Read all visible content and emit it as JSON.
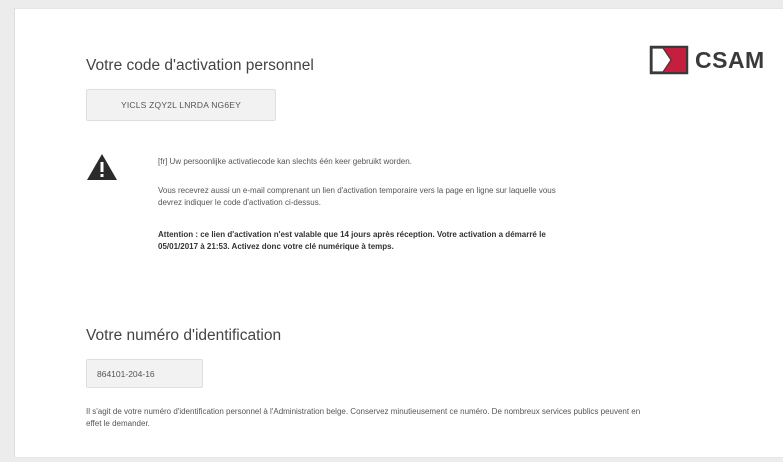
{
  "logo": {
    "text": "CSAM",
    "colors": {
      "mark": "#c41f3e",
      "frame": "#3a3a3a"
    }
  },
  "activation": {
    "title": "Votre code d'activation personnel",
    "code": "YICLS ZQY2L LNRDA NG6EY",
    "warning_icon": "warning-icon",
    "messages": {
      "nl": "[fr] Uw persoonlijke activatiecode kan slechts één keer gebruikt worden.",
      "email": "Vous recevrez aussi un e-mail comprenant un lien d'activation temporaire vers la page en ligne sur laquelle vous devrez indiquer le code d'activation ci-dessus.",
      "attention": "Attention : ce lien d'activation n'est valable que 14 jours après réception. Votre activation a démarré le 05/01/2017 à 21:53. Activez donc votre clé numérique à temps."
    }
  },
  "identification": {
    "title": "Votre numéro d'identification",
    "number": "864101-204-16",
    "note": "Il s'agit de votre numéro d'identification personnel à l'Administration belge. Conservez minutieusement ce numéro. De nombreux services publics peuvent en effet le demander."
  }
}
